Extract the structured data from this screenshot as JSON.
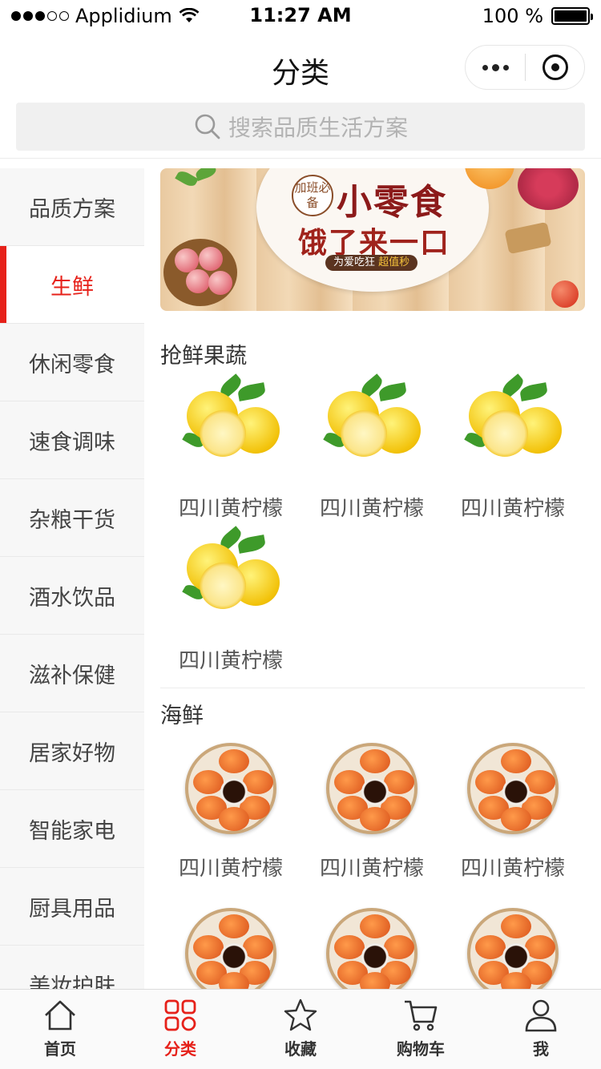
{
  "status_bar": {
    "carrier": "Applidium",
    "time": "11:27 AM",
    "battery": "100 %"
  },
  "nav": {
    "title": "分类"
  },
  "search": {
    "placeholder": "搜索品质生活方案"
  },
  "sidebar": {
    "items": [
      {
        "label": "品质方案"
      },
      {
        "label": "生鲜"
      },
      {
        "label": "休闲零食"
      },
      {
        "label": "速食调味"
      },
      {
        "label": "杂粮干货"
      },
      {
        "label": "酒水饮品"
      },
      {
        "label": "滋补保健"
      },
      {
        "label": "居家好物"
      },
      {
        "label": "智能家电"
      },
      {
        "label": "厨具用品"
      },
      {
        "label": "美妆护肤"
      }
    ],
    "active_index": 1
  },
  "banner": {
    "seal": "加班必备",
    "headline": "小零食",
    "subline": "饿了来一口",
    "tag_text": "为爱吃狂",
    "tag_highlight": "超值秒"
  },
  "sections": [
    {
      "title": "抢鲜果蔬",
      "products": [
        {
          "name": "四川黄柠檬",
          "icon": "lemon"
        },
        {
          "name": "四川黄柠檬",
          "icon": "lemon"
        },
        {
          "name": "四川黄柠檬",
          "icon": "lemon"
        },
        {
          "name": "四川黄柠檬",
          "icon": "lemon"
        }
      ]
    },
    {
      "title": "海鲜",
      "products": [
        {
          "name": "四川黄柠檬",
          "icon": "crab-plate"
        },
        {
          "name": "四川黄柠檬",
          "icon": "crab-plate"
        },
        {
          "name": "四川黄柠檬",
          "icon": "crab-plate"
        },
        {
          "name": "",
          "icon": "crab-plate"
        },
        {
          "name": "",
          "icon": "crab-plate"
        },
        {
          "name": "",
          "icon": "crab-plate"
        }
      ]
    }
  ],
  "tabbar": {
    "items": [
      {
        "label": "首页",
        "icon": "home-icon"
      },
      {
        "label": "分类",
        "icon": "category-icon"
      },
      {
        "label": "收藏",
        "icon": "star-icon"
      },
      {
        "label": "购物车",
        "icon": "cart-icon"
      },
      {
        "label": "我",
        "icon": "user-icon"
      }
    ],
    "active_index": 1
  },
  "colors": {
    "accent": "#e6211a",
    "sidebar_bg": "#f7f7f7"
  }
}
